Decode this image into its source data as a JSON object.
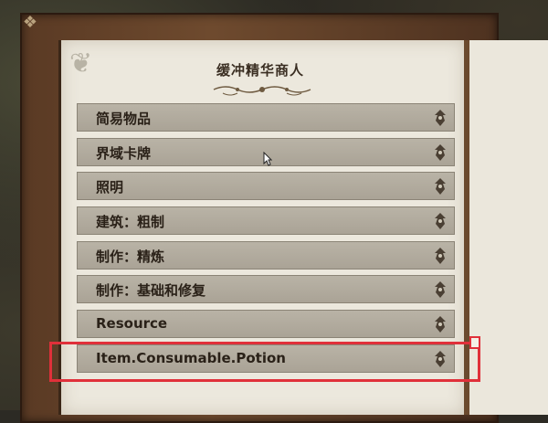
{
  "shop": {
    "title": "缓冲精华商人",
    "items": [
      {
        "label": "简易物品",
        "icon": "scroll-down-icon"
      },
      {
        "label": "界域卡牌",
        "icon": "scroll-down-icon"
      },
      {
        "label": "照明",
        "icon": "scroll-down-icon"
      },
      {
        "label": "建筑：粗制",
        "icon": "scroll-down-icon"
      },
      {
        "label": "制作：精炼",
        "icon": "scroll-down-icon"
      },
      {
        "label": "制作：基础和修复",
        "icon": "scroll-down-icon"
      },
      {
        "label": "Resource",
        "icon": "scroll-down-icon"
      },
      {
        "label": "Item.Consumable.Potion",
        "icon": "scroll-down-icon"
      }
    ],
    "highlighted_index": 7
  },
  "colors": {
    "highlight": "#e0303a",
    "parchment": "#ece8dd",
    "item_bg": "#b3ad9f",
    "frame_wood": "#5a3a24"
  }
}
